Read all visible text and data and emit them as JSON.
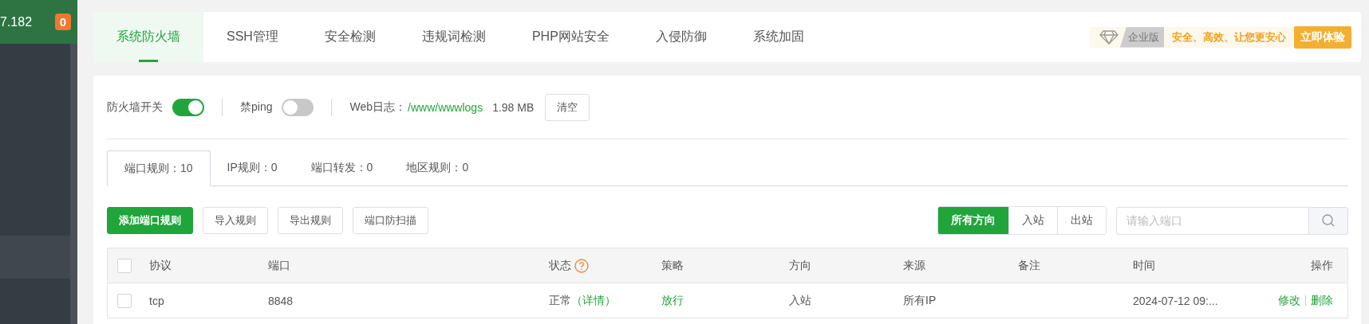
{
  "sidebar": {
    "server_ip": "7.182",
    "badge": "0"
  },
  "top_tabs": [
    {
      "label": "系统防火墙",
      "selected": true
    },
    {
      "label": "SSH管理",
      "selected": false
    },
    {
      "label": "安全检测",
      "selected": false
    },
    {
      "label": "违规词检测",
      "selected": false
    },
    {
      "label": "PHP网站安全",
      "selected": false
    },
    {
      "label": "入侵防御",
      "selected": false
    },
    {
      "label": "系统加固",
      "selected": false
    }
  ],
  "promo": {
    "edition": "企业版",
    "slogan": "安全、高效、让您更安心",
    "button": "立即体验"
  },
  "settings": {
    "firewall_switch": {
      "label": "防火墙开关",
      "on": true
    },
    "ping_switch": {
      "label": "禁ping",
      "on": false
    },
    "web_log": {
      "label": "Web日志：",
      "path": "/www/wwwlogs",
      "size": "1.98 MB",
      "button": "清空"
    }
  },
  "rule_tabs": [
    {
      "label": "端口规则：10",
      "selected": true
    },
    {
      "label": "IP规则：0",
      "selected": false
    },
    {
      "label": "端口转发：0",
      "selected": false
    },
    {
      "label": "地区规则：0",
      "selected": false
    }
  ],
  "actions": [
    {
      "label": "添加端口规则",
      "kind": "primary"
    },
    {
      "label": "导入规则",
      "kind": "default"
    },
    {
      "label": "导出规则",
      "kind": "default"
    },
    {
      "label": "端口防扫描",
      "kind": "default"
    }
  ],
  "direction_filter": [
    {
      "label": "所有方向",
      "selected": true
    },
    {
      "label": "入站",
      "selected": false
    },
    {
      "label": "出站",
      "selected": false
    }
  ],
  "search": {
    "placeholder": "请输入端口"
  },
  "table": {
    "select_all_checked": false,
    "columns": [
      "协议",
      "端口",
      "状态",
      "策略",
      "方向",
      "来源",
      "备注",
      "时间",
      "操作"
    ],
    "rows": [
      {
        "checked": false,
        "protocol": "tcp",
        "port": "8848",
        "status": "正常",
        "status_link": "（详情）",
        "policy": "放行",
        "direction": "入站",
        "source": "所有IP",
        "time": "2024-07-12 09:...",
        "actions": [
          "修改",
          "删除"
        ]
      }
    ]
  }
}
